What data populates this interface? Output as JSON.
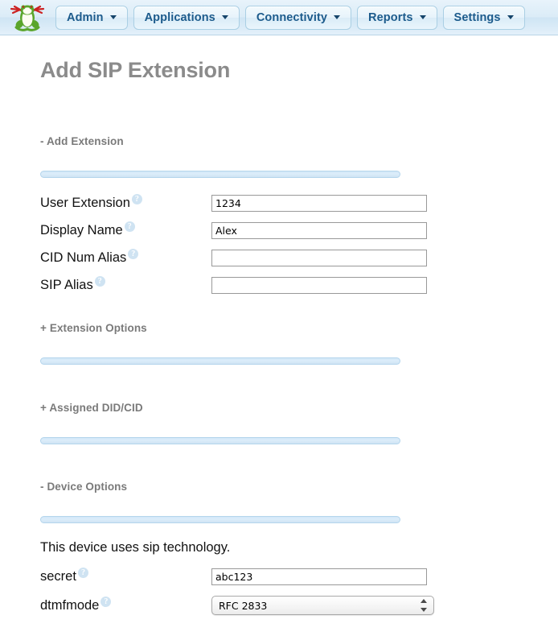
{
  "navbar": {
    "logo_icon": "frog-logo-icon",
    "items": [
      {
        "label": "Admin",
        "icon": "chevron-down-icon"
      },
      {
        "label": "Applications",
        "icon": "chevron-down-icon"
      },
      {
        "label": "Connectivity",
        "icon": "chevron-down-icon"
      },
      {
        "label": "Reports",
        "icon": "chevron-down-icon"
      },
      {
        "label": "Settings",
        "icon": "chevron-down-icon"
      }
    ]
  },
  "page": {
    "title": "Add SIP Extension"
  },
  "sections": {
    "add_extension": {
      "header": "- Add Extension",
      "fields": [
        {
          "label": "User Extension",
          "help_icon": "help-question-icon",
          "value": "1234",
          "placeholder": ""
        },
        {
          "label": "Display Name",
          "help_icon": "help-question-icon",
          "value": "Alex",
          "placeholder": ""
        },
        {
          "label": "CID Num Alias",
          "help_icon": "help-question-icon",
          "value": "",
          "placeholder": ""
        },
        {
          "label": "SIP Alias",
          "help_icon": "help-question-icon",
          "value": "",
          "placeholder": ""
        }
      ]
    },
    "extension_options": {
      "header": "+ Extension Options"
    },
    "assigned_did_cid": {
      "header": "+ Assigned DID/CID"
    },
    "device_options": {
      "header": "- Device Options",
      "note": "This device uses sip technology.",
      "secret": {
        "label": "secret",
        "help_icon": "help-question-icon",
        "value": "abc123",
        "placeholder": ""
      },
      "dtmfmode": {
        "label": "dtmfmode",
        "help_icon": "help-question-icon",
        "selected": "RFC 2833",
        "stepper_icon": "up-down-stepper-icon"
      }
    }
  },
  "colors": {
    "nav_text": "#1c5b8c",
    "nav_bg": "#dbecf7",
    "title_text": "#8b8b8b",
    "section_header_text": "#7a7a7a",
    "divider": "#cfe4f4",
    "help_icon": "#cfe3f2",
    "field_text": "#111111"
  }
}
